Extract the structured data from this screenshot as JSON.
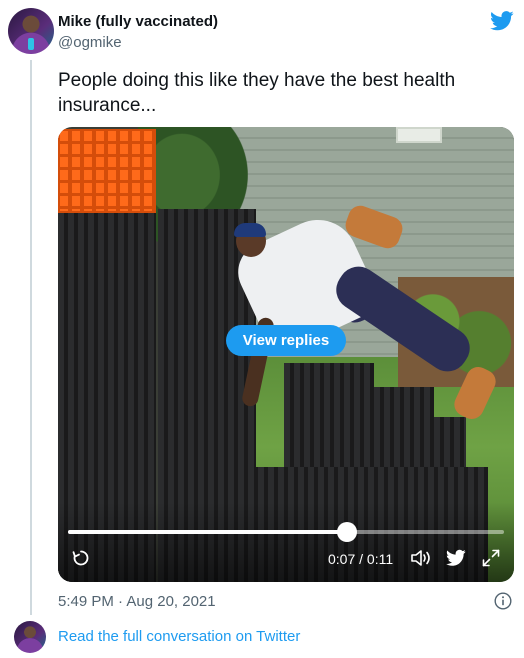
{
  "author": {
    "display_name": "Mike (fully vaccinated)",
    "handle": "@ogmike",
    "avatar_icon": "user-avatar"
  },
  "brand": {
    "icon": "twitter-bird-icon",
    "accent_color": "#1d9bf0"
  },
  "tweet": {
    "text": "People doing this like they have the best health insurance..."
  },
  "video": {
    "overlay_button": "View replies",
    "current_time": "0:07",
    "duration": "0:11",
    "time_display": "0:07 / 0:11",
    "progress_fraction": 0.64,
    "controls": {
      "replay_icon": "replay-icon",
      "volume_icon": "volume-icon",
      "brand_icon": "twitter-bird-icon",
      "fullscreen_icon": "fullscreen-icon"
    }
  },
  "footer": {
    "timestamp": "5:49 PM · Aug 20, 2021",
    "info_icon": "info-icon",
    "conversation_link": "Read the full conversation on Twitter"
  }
}
